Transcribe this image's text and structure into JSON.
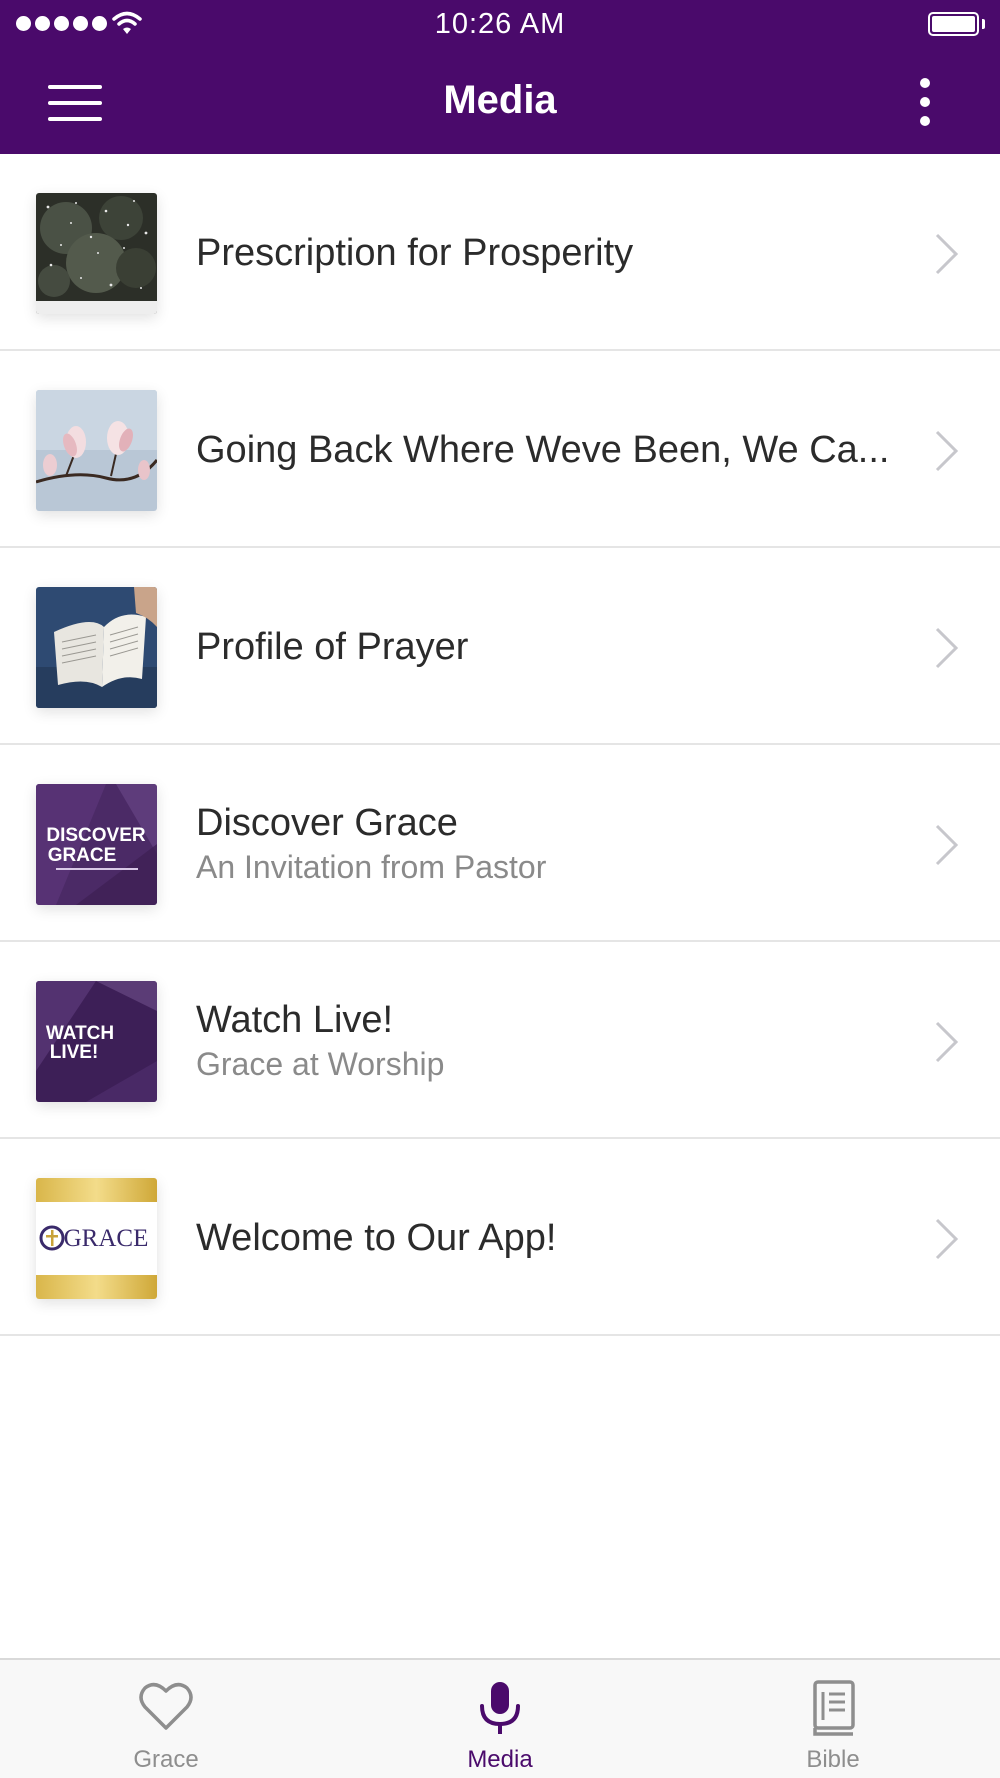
{
  "status_bar": {
    "time": "10:26 AM"
  },
  "header": {
    "title": "Media",
    "background_color": "#4a0a6b",
    "menu_icon": "hamburger-menu-icon",
    "more_icon": "more-vertical-icon"
  },
  "media_list": [
    {
      "title": "Prescription for Prosperity",
      "subtitle": ""
    },
    {
      "title": "Going Back Where Weve Been, We Ca...",
      "subtitle": ""
    },
    {
      "title": "Profile of Prayer",
      "subtitle": ""
    },
    {
      "title": "Discover Grace",
      "subtitle": "An Invitation from Pastor",
      "thumb_text": [
        "DISCOVER",
        "GRACE"
      ]
    },
    {
      "title": "Watch Live!",
      "subtitle": "Grace at Worship",
      "thumb_text": [
        "WATCH",
        "LIVE!"
      ]
    },
    {
      "title": "Welcome to Our App!",
      "subtitle": "",
      "thumb_text": [
        "GRACE"
      ]
    }
  ],
  "tab_bar": {
    "active_color": "#4a0a6b",
    "inactive_color": "#8e8e8e",
    "tabs": [
      {
        "label": "Grace",
        "icon": "heart-icon",
        "active": false
      },
      {
        "label": "Media",
        "icon": "microphone-icon",
        "active": true
      },
      {
        "label": "Bible",
        "icon": "book-icon",
        "active": false
      }
    ]
  }
}
